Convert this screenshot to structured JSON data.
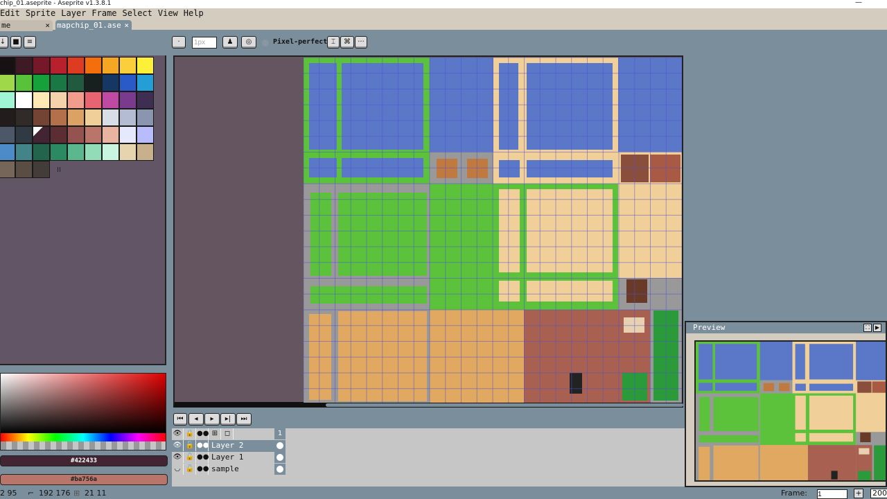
{
  "window": {
    "title": "chip_01.aseprite - Aseprite v1.3.8.1",
    "minimize": "—"
  },
  "menu": [
    "Edit",
    "Sprite",
    "Layer",
    "Frame",
    "Select",
    "View",
    "Help"
  ],
  "tabs": [
    {
      "label": "me",
      "close": "×",
      "active": false
    },
    {
      "label": "mapchip_01.ase",
      "close": "×",
      "active": true
    }
  ],
  "toolbar": {
    "brush_size": "1px",
    "pixel_perfect": "Pixel-perfect",
    "more": "···"
  },
  "palette": {
    "colors": [
      "#161214",
      "#3d1a24",
      "#76172a",
      "#b8202e",
      "#dd3c22",
      "#f46e0c",
      "#f5a623",
      "#fbce3c",
      "#fcf038",
      "#9fd848",
      "#58c23a",
      "#16a13a",
      "#1a7844",
      "#225a40",
      "#17201e",
      "#163664",
      "#2a5ac8",
      "#259ed8",
      "#a0f5d4",
      "#ffffff",
      "#fde9b5",
      "#f6d2ac",
      "#f29c8e",
      "#e76470",
      "#be4aa4",
      "#7a3a8e",
      "#3e2e52",
      "#221c1c",
      "#302a28",
      "#734334",
      "#b4704a",
      "#dca264",
      "#f0d098",
      "#d8dee8",
      "#b4bcd4",
      "#8a96b0",
      "#4c5868",
      "#303a44",
      "#422433",
      "#5c2e34",
      "#955350",
      "#ba756a",
      "#e8b4a0",
      "#e6e8fc",
      "#b8bcfc",
      "#4c8ac8",
      "#428488",
      "#23644c",
      "#2b8a62",
      "#5bb88e",
      "#92dcb8",
      "#c8f4e0",
      "#e6d4ae",
      "#c8b08c",
      "#76665a",
      "#5a4e44",
      "#443c38"
    ],
    "selected_index": 38
  },
  "colors": {
    "foreground": "#422433",
    "background": "#ba756a"
  },
  "timeline": {
    "frame_number": "1",
    "layers": [
      {
        "name": "Layer 2",
        "visible": true,
        "selected": true
      },
      {
        "name": "Layer 1",
        "visible": true,
        "selected": false
      },
      {
        "name": "sample",
        "visible": false,
        "selected": false
      }
    ]
  },
  "preview": {
    "title": "Preview"
  },
  "status": {
    "position": "2 95",
    "size": "192 176",
    "grid": "21 11",
    "frame_label": "Frame:",
    "frame_value": "1",
    "zoom": "200"
  }
}
